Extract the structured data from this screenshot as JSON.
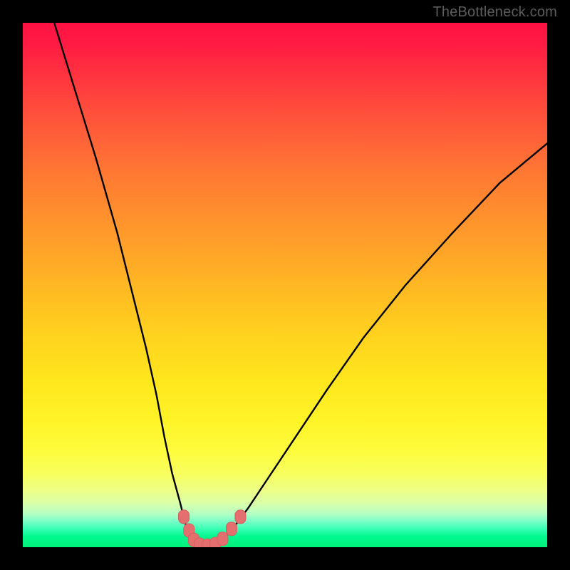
{
  "watermark": "TheBottleneck.com",
  "colors": {
    "curve": "#000000",
    "marker_fill": "#e46f6f",
    "marker_stroke": "#d85f5f",
    "frame": "#000000"
  },
  "chart_data": {
    "type": "line",
    "title": "",
    "xlabel": "",
    "ylabel": "",
    "xlim": [
      0,
      100
    ],
    "ylim": [
      0,
      100
    ],
    "grid": false,
    "legend": false,
    "note": "Bottleneck-style V curve; y expressed as bottleneck percentage (0 = ideal at valley). Values estimated from pixel positions against vertical span.",
    "series": [
      {
        "name": "bottleneck-curve",
        "x": [
          6,
          10,
          14,
          18,
          21,
          23.5,
          25.5,
          27,
          28.5,
          30,
          31,
          32,
          33,
          34,
          36,
          38,
          40,
          43,
          47,
          52,
          58,
          65,
          73,
          82,
          91,
          100
        ],
        "values": [
          100,
          87,
          74,
          60,
          48,
          38,
          29,
          21,
          14,
          8.5,
          4.5,
          2,
          0.8,
          0.3,
          0.3,
          1.2,
          3.5,
          7.5,
          13.5,
          21,
          30,
          40,
          50,
          60,
          69.5,
          77
        ]
      }
    ],
    "markers": {
      "name": "highlight-cluster",
      "note": "Small salmon rounded markers near the valley",
      "points_xy": [
        [
          30.7,
          5.8
        ],
        [
          31.7,
          3.2
        ],
        [
          32.6,
          1.4
        ],
        [
          33.7,
          0.5
        ],
        [
          35.2,
          0.3
        ],
        [
          36.7,
          0.6
        ],
        [
          38.1,
          1.6
        ],
        [
          39.8,
          3.5
        ],
        [
          41.5,
          5.8
        ]
      ]
    }
  }
}
